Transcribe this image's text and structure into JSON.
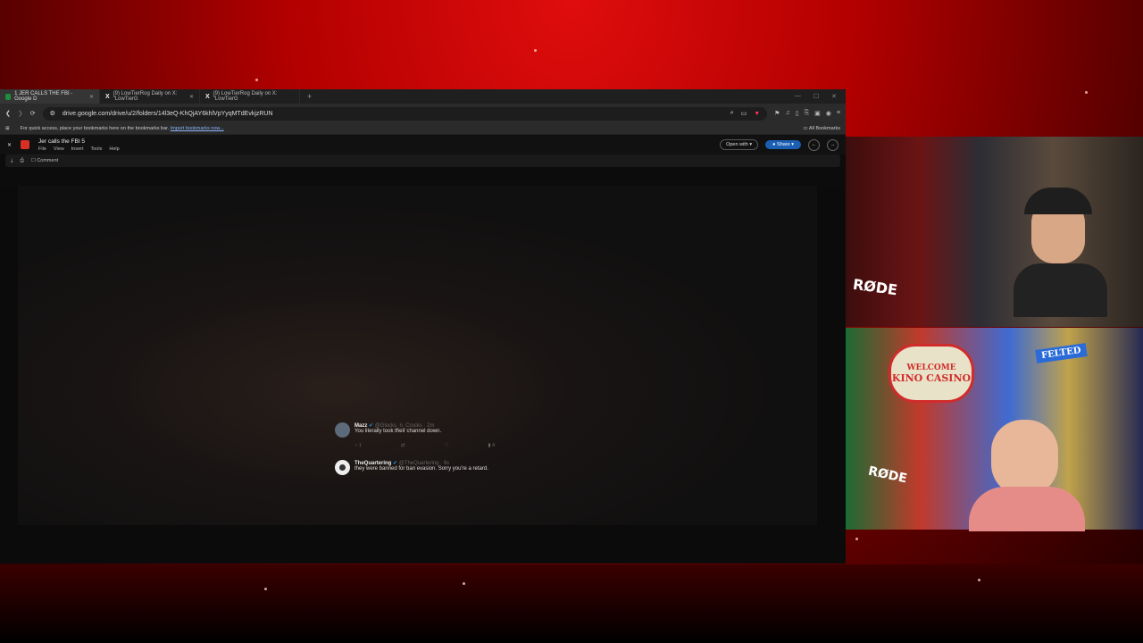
{
  "browser": {
    "tabs": [
      {
        "label": "1 JER CALLS THE FBI - Google D",
        "active": true
      },
      {
        "label": "(9) LowTierRog Daily on X: \"LowTierG",
        "active": false
      },
      {
        "label": "(9) LowTierRog Daily on X: \"LowTierG",
        "active": false
      }
    ],
    "url": "drive.google.com/drive/u/2/folders/14l3eQ-KhQjAY6khlVpYyqMTdEvkjzRUN",
    "bookmarks_hint": "For quick access, place your bookmarks here on the bookmarks bar.",
    "import_link": "Import bookmarks now...",
    "all_bookmarks": "All Bookmarks"
  },
  "doc": {
    "title": "Jer calls the FBI 5",
    "menus": [
      "File",
      "View",
      "Insert",
      "Tools",
      "Help"
    ],
    "open_with": "Open with",
    "share": "Share",
    "comment": "Comment"
  },
  "tweets": [
    {
      "name": "Mazz",
      "handle": "@Glocks_n_Crocks · 2m",
      "text": "You literally took their channel down.",
      "reply_count": "1",
      "view_count": "4"
    },
    {
      "name": "TheQuartering",
      "handle": "@TheQuartering · 9s",
      "text": "they were banned for ban evasion. Sorry you're a retard."
    }
  ],
  "cams": {
    "sign_welcome": "WELCOME",
    "sign_casino": "KINO CASINO",
    "felted": "FELTED",
    "mic_brand": "RØDE"
  }
}
